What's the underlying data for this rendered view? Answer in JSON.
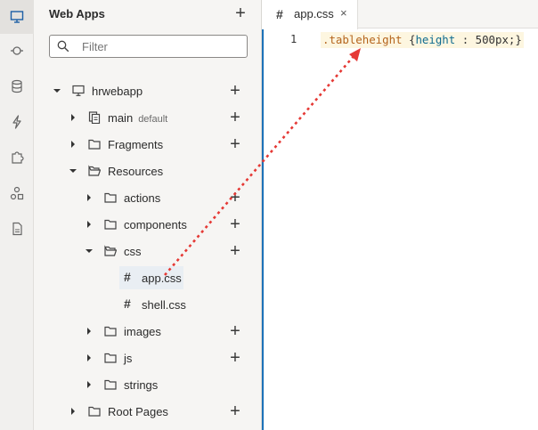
{
  "activity_bar": {
    "items": [
      {
        "name": "web-apps",
        "icon": "monitor-icon",
        "active": true
      },
      {
        "name": "services",
        "icon": "services-icon",
        "active": false
      },
      {
        "name": "business-objects",
        "icon": "database-icon",
        "active": false
      },
      {
        "name": "processes",
        "icon": "lightning-icon",
        "active": false
      },
      {
        "name": "components",
        "icon": "puzzle-icon",
        "active": false
      },
      {
        "name": "layouts",
        "icon": "shapes-icon",
        "active": false
      },
      {
        "name": "source",
        "icon": "file-icon",
        "active": false
      }
    ]
  },
  "navigator": {
    "title": "Web Apps",
    "filter_placeholder": "Filter",
    "tree": [
      {
        "label": "hrwebapp",
        "icon": "monitor-icon",
        "expanded": true
      },
      {
        "label": "main",
        "badge": "default",
        "icon": "page-flow-icon",
        "expanded": false
      },
      {
        "label": "Fragments",
        "icon": "folder-icon",
        "expanded": false
      },
      {
        "label": "Resources",
        "icon": "folder-open-icon",
        "expanded": true
      },
      {
        "label": "actions",
        "icon": "folder-icon",
        "expanded": false
      },
      {
        "label": "components",
        "icon": "folder-icon",
        "expanded": false
      },
      {
        "label": "css",
        "icon": "folder-open-icon",
        "expanded": true
      },
      {
        "label": "app.css",
        "icon": "hash-icon",
        "selected": true
      },
      {
        "label": "shell.css",
        "icon": "hash-icon"
      },
      {
        "label": "images",
        "icon": "folder-icon",
        "expanded": false
      },
      {
        "label": "js",
        "icon": "folder-icon",
        "expanded": false
      },
      {
        "label": "strings",
        "icon": "folder-icon",
        "expanded": false
      },
      {
        "label": "Root Pages",
        "icon": "folder-icon",
        "expanded": false
      }
    ]
  },
  "editor": {
    "tab": {
      "label": "app.css",
      "icon": "hash-icon",
      "close": "×"
    },
    "lines": [
      {
        "number": "1",
        "selector": ".tableheight",
        "open": "{",
        "property": "height",
        "sep": " : ",
        "value": "500px;",
        "close": "}"
      }
    ]
  },
  "colors": {
    "accent": "#1d72b8",
    "arrow": "#e53935",
    "code_highlight": "#fdf6e0"
  }
}
